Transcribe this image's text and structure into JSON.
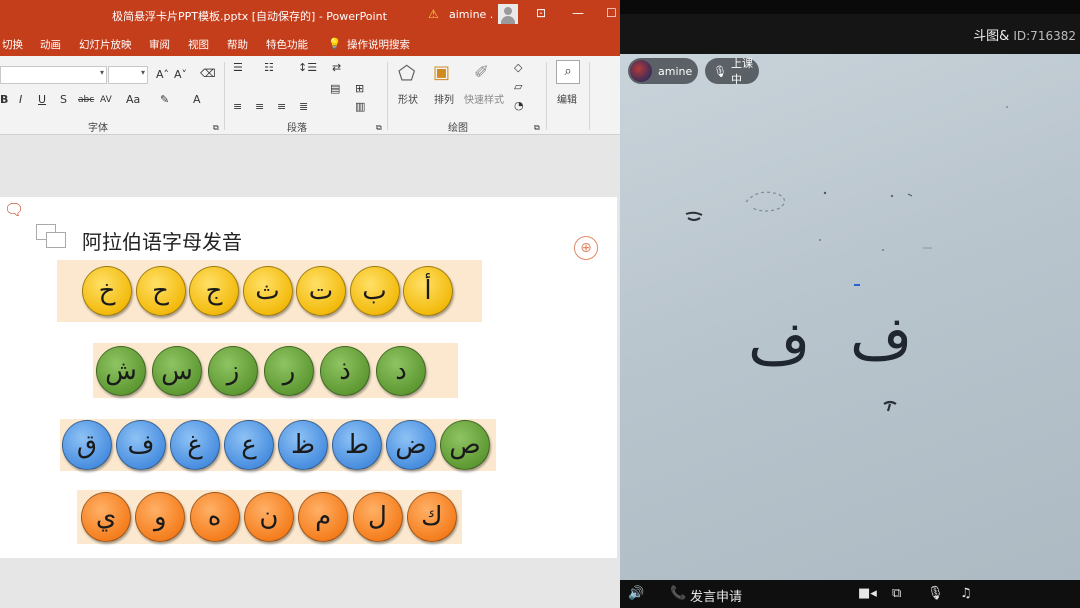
{
  "ppt": {
    "title": "极简悬浮卡片PPT模板.pptx [自动保存的] - PowerPoint",
    "warning_icon": "warning-icon",
    "user": "aimine .",
    "menu": [
      "切换",
      "动画",
      "幻灯片放映",
      "审阅",
      "视图",
      "帮助",
      "特色功能",
      "操作说明搜索"
    ],
    "ribbon": {
      "font_group": "字体",
      "paragraph_group": "段落",
      "drawing_group": "绘图",
      "shapes": "形状",
      "arrange": "排列",
      "quick_styles": "快速样式",
      "edit": "编辑"
    },
    "slide": {
      "title": "阿拉伯语字母发音",
      "rows": [
        {
          "color": "yellow",
          "letters": [
            "خ",
            "ح",
            "ج",
            "ث",
            "ت",
            "ب",
            "أ"
          ]
        },
        {
          "color": "green",
          "letters": [
            "ش",
            "س",
            "ز",
            "ر",
            "ذ",
            "د"
          ]
        },
        {
          "color": "blue",
          "letters": [
            "ق",
            "ف",
            "غ",
            "ع",
            "ظ",
            "ط",
            "ض"
          ],
          "last": {
            "letter": "ص",
            "color": "green"
          }
        },
        {
          "color": "orange",
          "letters": [
            "ي",
            "و",
            "ه",
            "ن",
            "م",
            "ل",
            "ك"
          ]
        }
      ]
    }
  },
  "stream": {
    "brand": "斗图&",
    "id_label": "ID:716382",
    "host_name": "amine",
    "status": "上课中",
    "bottom": {
      "speak_request": "发言申请"
    },
    "whiteboard_letters": [
      "ف",
      "ف"
    ]
  },
  "colors": {
    "ppt_red": "#c43e1c",
    "yellow": "#f3bb0e",
    "green": "#5f9a34",
    "blue": "#4a8fe0",
    "orange": "#f57f1f"
  }
}
